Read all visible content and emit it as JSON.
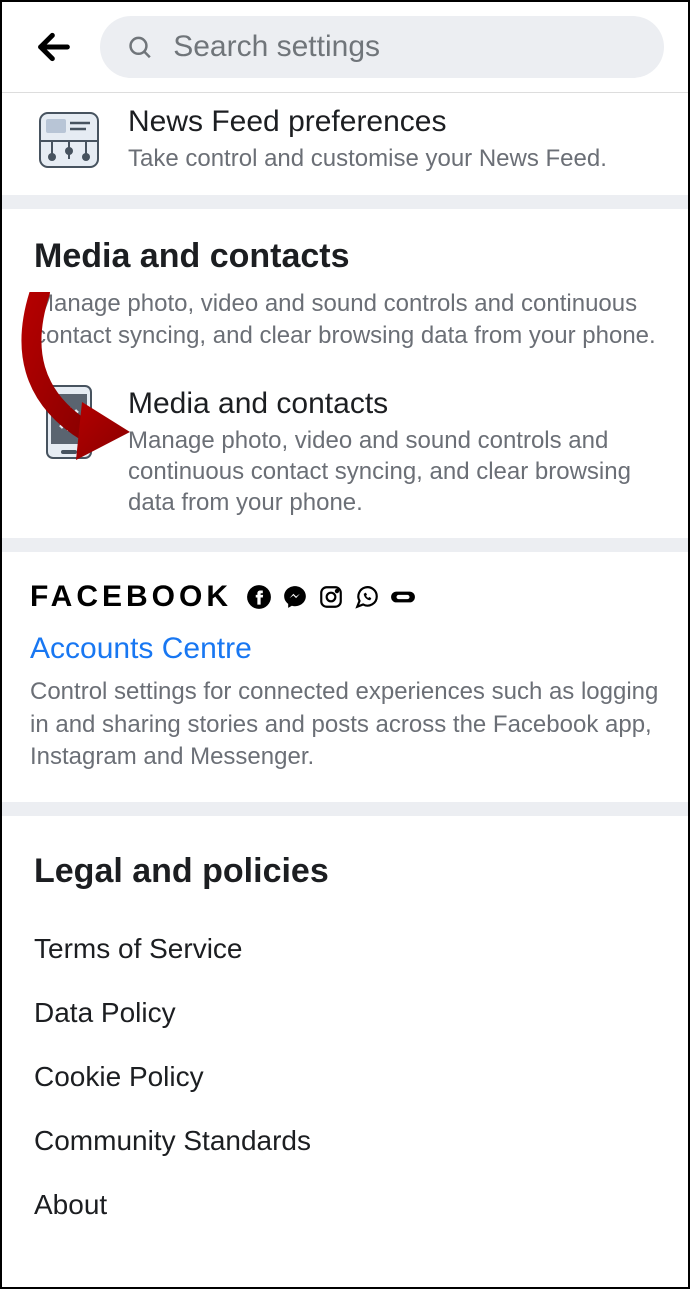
{
  "header": {
    "search_placeholder": "Search settings"
  },
  "newsfeed": {
    "title": "News Feed preferences",
    "desc": "Take control and customise your News Feed."
  },
  "media_section": {
    "heading": "Media and contacts",
    "sub": "Manage photo, video and sound controls and continuous contact syncing, and clear browsing data from your phone.",
    "item_title": "Media and contacts",
    "item_desc": "Manage photo, video and sound controls and continuous contact syncing, and clear browsing data from your phone."
  },
  "fb_bar": {
    "word": "FACEBOOK"
  },
  "accounts": {
    "link": "Accounts Centre",
    "desc": "Control settings for connected experiences such as logging in and sharing stories and posts across the Facebook app, Instagram and Messenger."
  },
  "legal": {
    "heading": "Legal and policies",
    "items": [
      "Terms of Service",
      "Data Policy",
      "Cookie Policy",
      "Community Standards",
      "About"
    ]
  }
}
